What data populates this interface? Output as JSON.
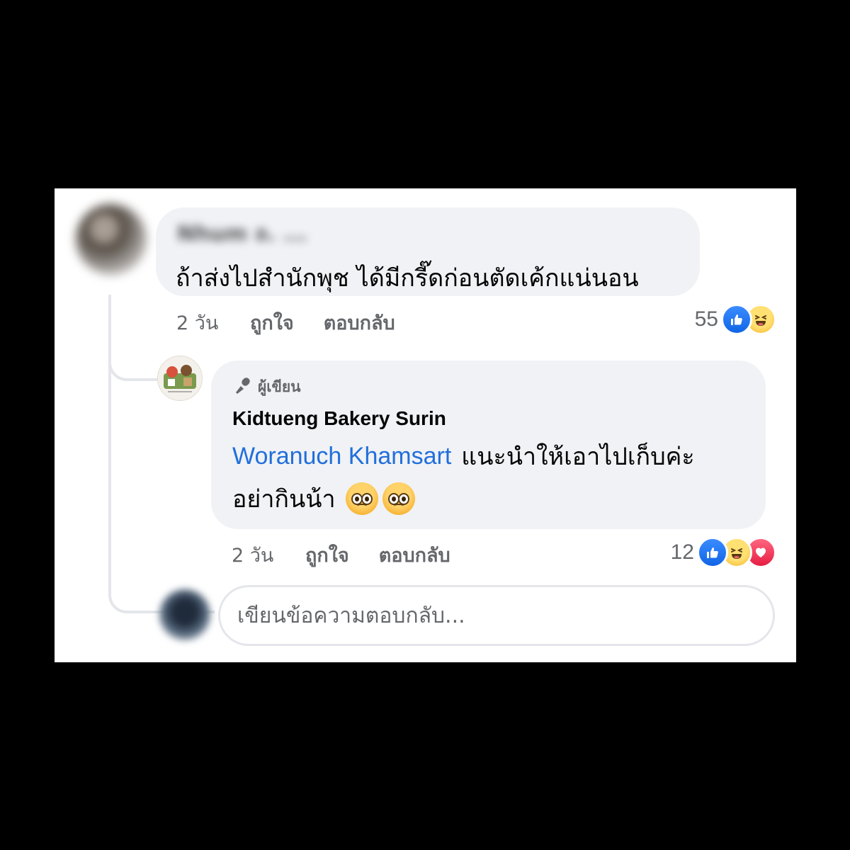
{
  "comment": {
    "author_name": "Nhum ล. ...",
    "text": "ถ้าส่งไปสำนักพุช ได้มีกรี๊ดก่อนตัดเค้กแน่นอน",
    "time": "2 วัน",
    "like_label": "ถูกใจ",
    "reply_label": "ตอบกลับ",
    "reaction_count": "55",
    "reactions": [
      "like",
      "haha"
    ]
  },
  "reply": {
    "badge_label": "ผู้เขียน",
    "badge_icon": "microphone-icon",
    "author_name": "Kidtueng Bakery Surin",
    "mention": "Woranuch Khamsart",
    "text_line1": "แนะนำให้เอาไปเก็บค่ะ",
    "text_line2": "อย่ากินน้า",
    "emoji": "pleading-face-icon",
    "time": "2 วัน",
    "like_label": "ถูกใจ",
    "reply_label": "ตอบกลับ",
    "reaction_count": "12",
    "reactions": [
      "like",
      "haha",
      "love"
    ]
  },
  "composer": {
    "placeholder": "เขียนข้อความตอบกลับ..."
  },
  "colors": {
    "bubble": "#f0f2f5",
    "secondary_text": "#65676b",
    "mention": "#216fdb",
    "like": "#1877f2",
    "love": "#f33e58",
    "haha": "#f7b125"
  }
}
